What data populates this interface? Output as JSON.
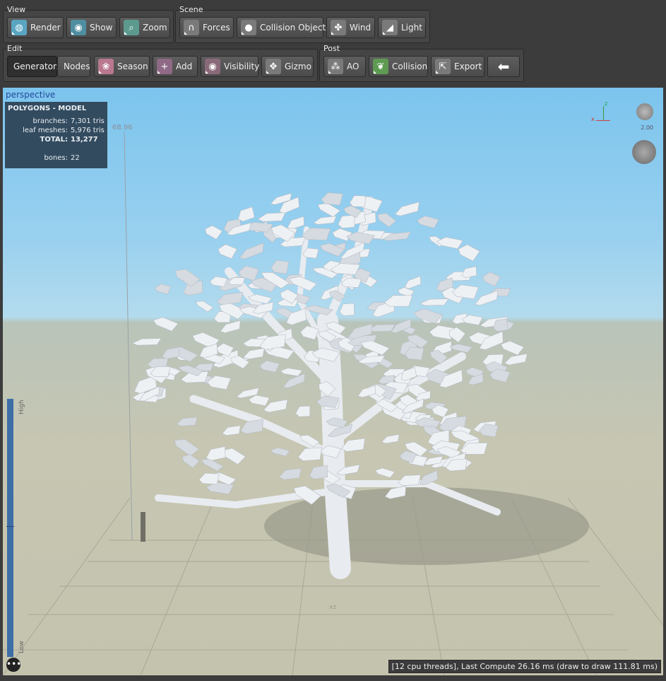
{
  "toolbar": {
    "view": {
      "label": "View",
      "buttons": [
        {
          "label": "Render",
          "icon": "globe-icon"
        },
        {
          "label": "Show",
          "icon": "eye-icon"
        },
        {
          "label": "Zoom",
          "icon": "magnifier-icon"
        }
      ]
    },
    "scene": {
      "label": "Scene",
      "buttons": [
        {
          "label": "Forces",
          "icon": "magnet-icon"
        },
        {
          "label": "Collision Objects",
          "icon": "sphere-icon"
        },
        {
          "label": "Wind",
          "icon": "fan-icon"
        },
        {
          "label": "Light",
          "icon": "lamp-icon"
        }
      ]
    },
    "edit": {
      "label": "Edit",
      "buttons": [
        {
          "label": "Generators",
          "active": true
        },
        {
          "label": "Nodes"
        },
        {
          "label": "Season",
          "icon": "season-icon"
        },
        {
          "label": "Add",
          "icon": "add-node-icon"
        },
        {
          "label": "Visibility",
          "icon": "eye-icon"
        },
        {
          "label": "Gizmo",
          "icon": "gizmo-icon"
        }
      ]
    },
    "post": {
      "label": "Post",
      "buttons": [
        {
          "label": "AO",
          "icon": "ao-icon"
        },
        {
          "label": "Collision",
          "icon": "leaf-icon"
        },
        {
          "label": "Export",
          "icon": "export-icon"
        },
        {
          "label": "",
          "icon": "back-arrow-icon"
        }
      ]
    }
  },
  "viewport": {
    "title": "perspective",
    "height_label": "68.96",
    "scale_high": "High",
    "scale_low": "Low",
    "axis_z": "z",
    "axis_x": "x",
    "zoom_readout": "2.00",
    "ground_label": "xz",
    "stats": {
      "header": "POLYGONS - MODEL",
      "rows": [
        {
          "k": "branches:",
          "v": "7,301 tris"
        },
        {
          "k": "leaf meshes:",
          "v": "5,976 tris"
        },
        {
          "k": "TOTAL:",
          "v": "13,277",
          "bold": true
        },
        {
          "k": "bones:",
          "v": "22"
        }
      ]
    },
    "status": "[12 cpu threads], Last Compute 26.16 ms (draw to draw 111.81 ms)",
    "menu_glyph": "•••"
  },
  "colors": {
    "sky_top": "#7cc4ee",
    "ground": "#c4c3ae",
    "stats_bg": "#334b5f",
    "panel": "#3c3c3c"
  }
}
